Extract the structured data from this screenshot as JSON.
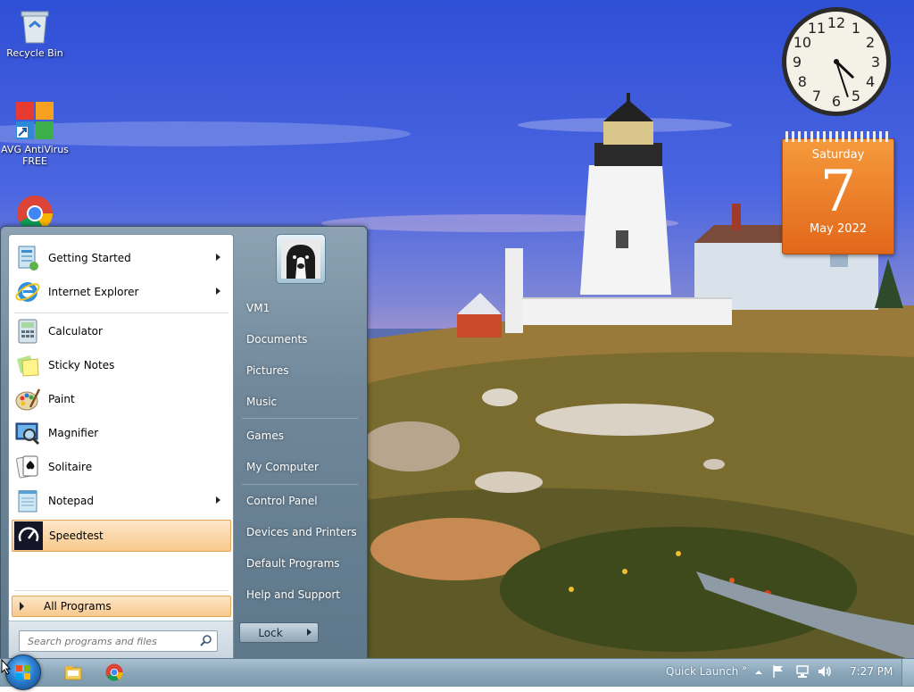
{
  "desktop": {
    "icons": [
      {
        "label": "Recycle Bin",
        "icon": "recycle-bin-icon"
      },
      {
        "label": "AVG AntiVirus FREE",
        "icon": "avg-antivirus-icon"
      },
      {
        "label": "",
        "icon": "chrome-icon"
      }
    ]
  },
  "gadgets": {
    "clock": {
      "hour": 4,
      "minute": 27,
      "numbers": [
        "12",
        "1",
        "2",
        "3",
        "4",
        "5",
        "6",
        "7",
        "8",
        "9",
        "10",
        "11"
      ]
    },
    "calendar": {
      "weekday": "Saturday",
      "day": "7",
      "month_year": "May 2022"
    }
  },
  "start_menu": {
    "programs": [
      {
        "label": "Getting Started",
        "icon": "getting-started-icon",
        "has_submenu": true
      },
      {
        "label": "Internet Explorer",
        "icon": "internet-explorer-icon",
        "has_submenu": true
      },
      {
        "label": "Calculator",
        "icon": "calculator-icon",
        "has_submenu": false
      },
      {
        "label": "Sticky Notes",
        "icon": "sticky-notes-icon",
        "has_submenu": false
      },
      {
        "label": "Paint",
        "icon": "paint-icon",
        "has_submenu": false
      },
      {
        "label": "Magnifier",
        "icon": "magnifier-icon",
        "has_submenu": false
      },
      {
        "label": "Solitaire",
        "icon": "solitaire-icon",
        "has_submenu": false
      },
      {
        "label": "Notepad",
        "icon": "notepad-icon",
        "has_submenu": true
      },
      {
        "label": "Speedtest",
        "icon": "speedtest-icon",
        "has_submenu": false,
        "highlighted": true
      }
    ],
    "all_programs_label": "All Programs",
    "search_placeholder": "Search programs and files",
    "right_items": [
      "VM1",
      "Documents",
      "Pictures",
      "Music",
      "Games",
      "My Computer",
      "Control Panel",
      "Devices and Printers",
      "Default Programs",
      "Help and Support"
    ],
    "lock_label": "Lock"
  },
  "taskbar": {
    "quick_launch_label": "Quick Launch",
    "chevron": "»",
    "time": "7:27 PM",
    "pinned": [
      "file-explorer-icon",
      "chrome-icon"
    ]
  },
  "colors": {
    "highlight": "#f8c98c",
    "calendar": "#e2671a",
    "taskbar": "#8aa6b9"
  }
}
